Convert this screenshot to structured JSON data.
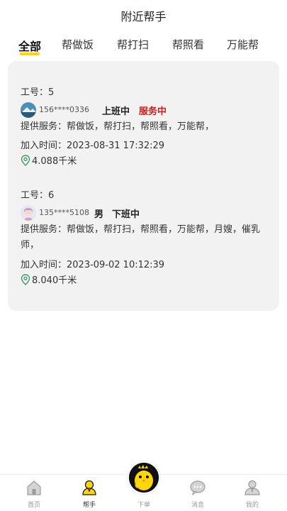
{
  "header": {
    "title": "附近帮手"
  },
  "tabs": [
    {
      "label": "全部",
      "active": true
    },
    {
      "label": "帮做饭"
    },
    {
      "label": "帮打扫"
    },
    {
      "label": "帮照看"
    },
    {
      "label": "万能帮"
    }
  ],
  "workers": [
    {
      "id_label": "工号：5",
      "phone": "156****0336",
      "gender": "",
      "work_status": "上班中",
      "service_state": "服务中",
      "services": "提供服务：帮做饭，帮打扫，帮照看，万能帮，",
      "joined": "加入时间：2023-08-31 17:32:29",
      "distance": "4.088千米"
    },
    {
      "id_label": "工号：6",
      "phone": "135****5108",
      "gender": "男",
      "work_status": "下班中",
      "service_state": "",
      "services": "提供服务：帮做饭，帮打扫，帮照看，万能帮，月嫂，催乳师，",
      "joined": "加入时间：2023-09-02 10:12:39",
      "distance": "8.040千米"
    }
  ],
  "tabbar": {
    "home": "首页",
    "helper": "帮手",
    "order": "下单",
    "messages": "消息",
    "mine": "我的"
  },
  "colors": {
    "accent": "#ffd60a",
    "status_red": "#d11a1a",
    "card_bg": "#f2f2f2"
  }
}
